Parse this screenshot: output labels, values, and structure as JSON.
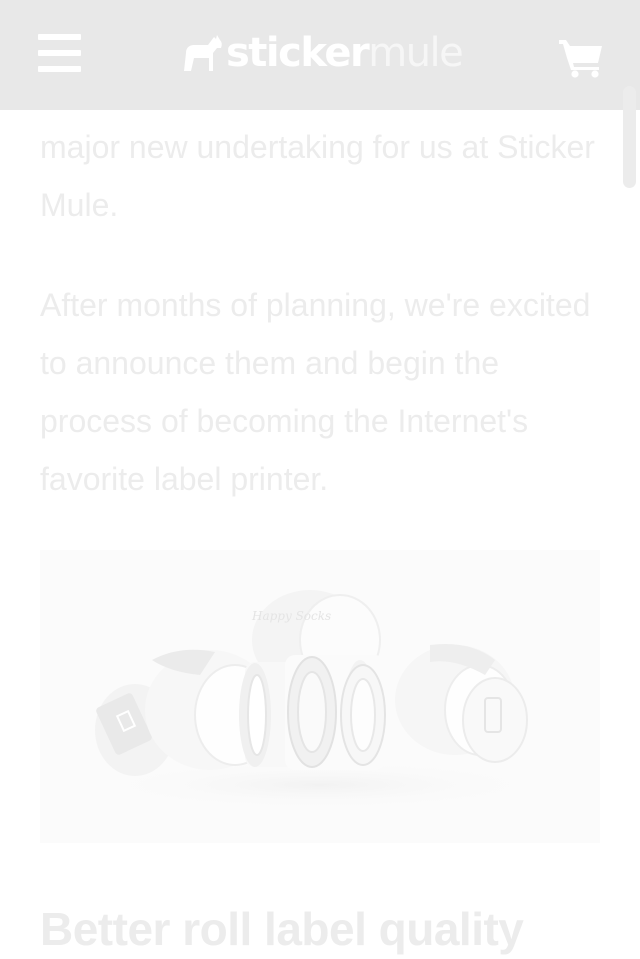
{
  "header": {
    "menu_icon": "hamburger-menu-icon",
    "logo": {
      "word1": "sticker",
      "word2": "mule",
      "mark_icon": "mule-icon"
    },
    "cart_icon": "shopping-cart-icon",
    "background": "#e8e8e8"
  },
  "article": {
    "paragraph_1": "major new undertaking for us at Sticker Mule.",
    "paragraph_2": "After months of planning, we're excited to announce them and begin the process of becoming the Internet's favorite label printer.",
    "hero_image": {
      "subject": "roll-labels-photo",
      "roll_text": "Happy Socks"
    },
    "heading": "Better roll label quality"
  },
  "colors": {
    "text_faded": "#ececec",
    "image_bg": "#fbfbfb"
  }
}
